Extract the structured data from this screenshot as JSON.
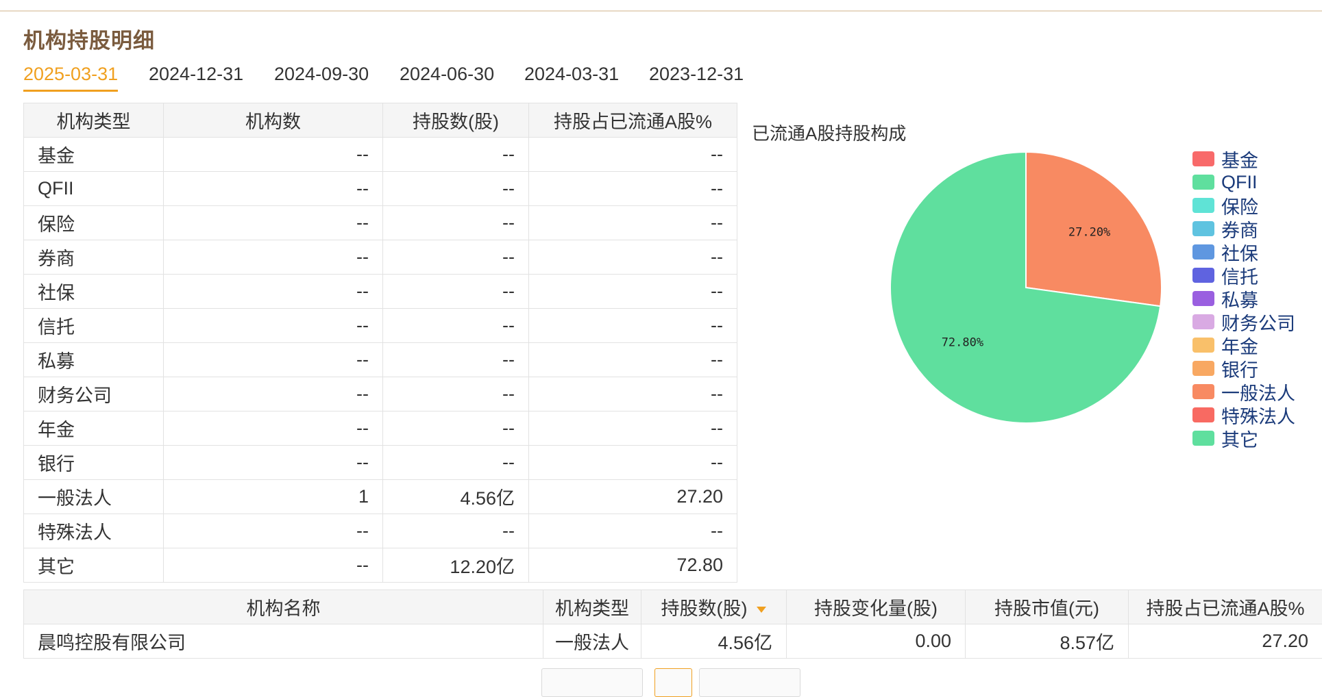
{
  "section_title": "机构持股明细",
  "date_tabs": [
    "2025-03-31",
    "2024-12-31",
    "2024-09-30",
    "2024-06-30",
    "2024-03-31",
    "2023-12-31"
  ],
  "active_tab": "2025-03-31",
  "institution_table": {
    "headers": [
      "机构类型",
      "机构数",
      "持股数(股)",
      "持股占已流通A股%"
    ],
    "rows": [
      [
        "基金",
        "--",
        "--",
        "--"
      ],
      [
        "QFII",
        "--",
        "--",
        "--"
      ],
      [
        "保险",
        "--",
        "--",
        "--"
      ],
      [
        "券商",
        "--",
        "--",
        "--"
      ],
      [
        "社保",
        "--",
        "--",
        "--"
      ],
      [
        "信托",
        "--",
        "--",
        "--"
      ],
      [
        "私募",
        "--",
        "--",
        "--"
      ],
      [
        "财务公司",
        "--",
        "--",
        "--"
      ],
      [
        "年金",
        "--",
        "--",
        "--"
      ],
      [
        "银行",
        "--",
        "--",
        "--"
      ],
      [
        "一般法人",
        "1",
        "4.56亿",
        "27.20"
      ],
      [
        "特殊法人",
        "--",
        "--",
        "--"
      ],
      [
        "其它",
        "--",
        "12.20亿",
        "72.80"
      ]
    ]
  },
  "chart_data": {
    "type": "pie",
    "title": "已流通A股持股构成",
    "slices": [
      {
        "label": "一般法人",
        "value": 27.2,
        "display": "27.20%",
        "color": "#f88a62"
      },
      {
        "label": "其它",
        "value": 72.8,
        "display": "72.80%",
        "color": "#5fdf9e"
      }
    ],
    "legend": [
      {
        "label": "基金",
        "color": "#f86a6a"
      },
      {
        "label": "QFII",
        "color": "#5fdf9e"
      },
      {
        "label": "保险",
        "color": "#5fe3d6"
      },
      {
        "label": "券商",
        "color": "#5fc3e0"
      },
      {
        "label": "社保",
        "color": "#5f97e0"
      },
      {
        "label": "信托",
        "color": "#5f63e0"
      },
      {
        "label": "私募",
        "color": "#9a5fe0"
      },
      {
        "label": "财务公司",
        "color": "#d9aae3"
      },
      {
        "label": "年金",
        "color": "#f9c06a"
      },
      {
        "label": "银行",
        "color": "#f8a862"
      },
      {
        "label": "一般法人",
        "color": "#f88a62"
      },
      {
        "label": "特殊法人",
        "color": "#f86a62"
      },
      {
        "label": "其它",
        "color": "#5fdf9e"
      }
    ],
    "legend_position": "right"
  },
  "holder_table": {
    "headers": [
      "机构名称",
      "机构类型",
      "持股数(股)",
      "持股变化量(股)",
      "持股市值(元)",
      "持股占已流通A股%"
    ],
    "sorted_column": "持股数(股)",
    "rows": [
      [
        "晨鸣控股有限公司",
        "一般法人",
        "4.56亿",
        "0.00",
        "8.57亿",
        "27.20"
      ]
    ]
  },
  "colors": {
    "accent": "#f0a020",
    "title_brown": "#7a5b3e",
    "legend_text": "#1a3a7a"
  }
}
